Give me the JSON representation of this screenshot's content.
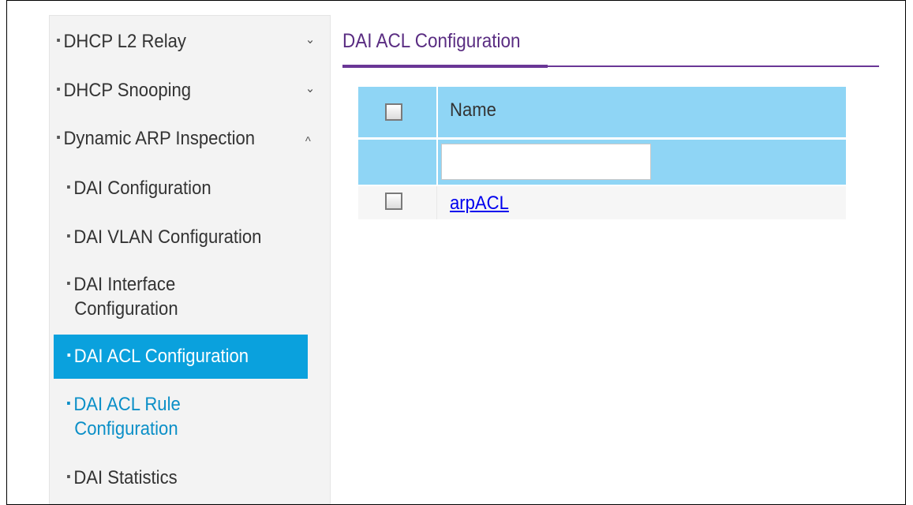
{
  "sidebar": {
    "items": [
      {
        "label": "DHCP L2 Relay",
        "chevron": "⌄",
        "chevron_icon": "chevron-down-icon"
      },
      {
        "label": "DHCP Snooping",
        "chevron": "⌄",
        "chevron_icon": "chevron-down-icon"
      },
      {
        "label": "Dynamic ARP Inspection",
        "chevron": "^",
        "chevron_icon": "chevron-up-icon"
      },
      {
        "label": "DAI Configuration"
      },
      {
        "label": "DAI VLAN Configuration"
      },
      {
        "label_line1": "DAI Interface",
        "label_line2": "Configuration"
      },
      {
        "label": "DAI ACL Configuration",
        "state": "active"
      },
      {
        "label_line1": "DAI ACL Rule",
        "label_line2": "Configuration"
      },
      {
        "label": "DAI Statistics"
      }
    ]
  },
  "main": {
    "title": "DAI ACL Configuration",
    "table": {
      "header": {
        "name": "Name"
      },
      "filter": {
        "value": "",
        "placeholder": ""
      },
      "rows": [
        {
          "name": "arpACL",
          "checked": false
        }
      ]
    }
  },
  "colors": {
    "accent_purple": "#5a2d82",
    "active_nav": "#0aa1dd",
    "table_header": "#8fd5f5",
    "link": "#0000ee"
  }
}
